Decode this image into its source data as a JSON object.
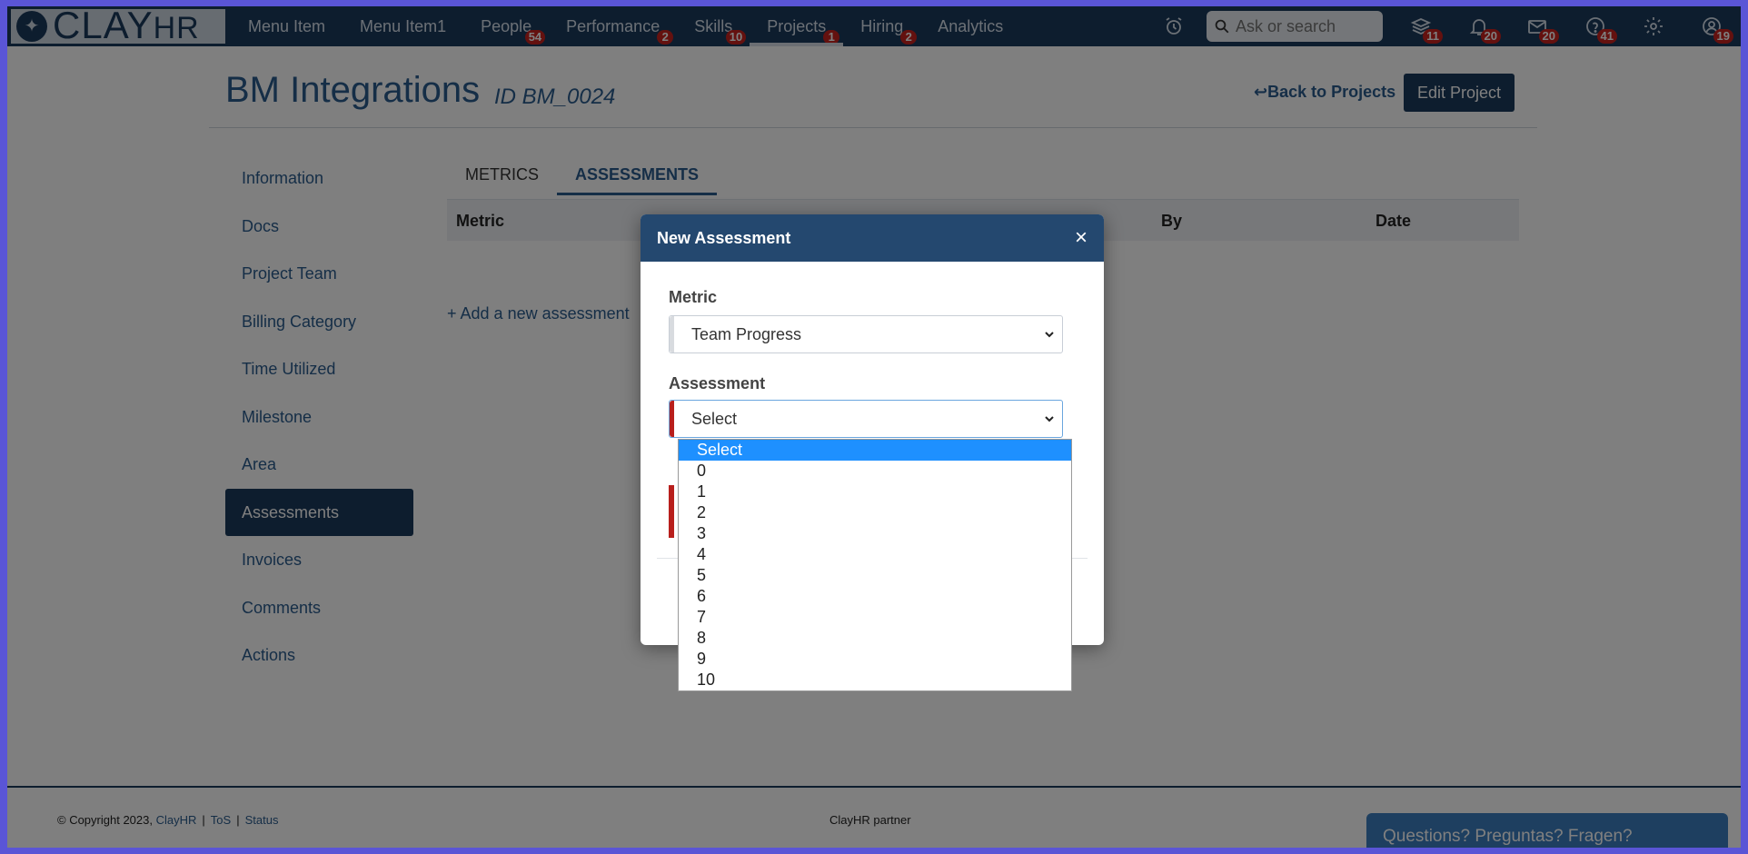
{
  "brand": {
    "logo_main": "CLAY",
    "logo_sub": "HR"
  },
  "nav": {
    "items": [
      {
        "label": "Menu Item",
        "badge": ""
      },
      {
        "label": "Menu Item1",
        "badge": ""
      },
      {
        "label": "People",
        "badge": "54"
      },
      {
        "label": "Performance",
        "badge": "2"
      },
      {
        "label": "Skills",
        "badge": "10"
      },
      {
        "label": "Projects",
        "badge": "1"
      },
      {
        "label": "Hiring",
        "badge": "2"
      },
      {
        "label": "Analytics",
        "badge": ""
      }
    ],
    "search_placeholder": "Ask or search",
    "badges": {
      "courses": "11",
      "notifications": "20",
      "messages": "20",
      "help": "41",
      "profile": "19"
    }
  },
  "page": {
    "title": "BM Integrations",
    "id": "ID BM_0024",
    "back_label": "Back to Projects",
    "edit_label": "Edit Project"
  },
  "sidebar": {
    "items": [
      {
        "label": "Information"
      },
      {
        "label": "Docs"
      },
      {
        "label": "Project Team"
      },
      {
        "label": "Billing Category"
      },
      {
        "label": "Time Utilized"
      },
      {
        "label": "Milestone"
      },
      {
        "label": "Area"
      },
      {
        "label": "Assessments"
      },
      {
        "label": "Invoices"
      },
      {
        "label": "Comments"
      },
      {
        "label": "Actions"
      }
    ]
  },
  "tabs": [
    {
      "label": "METRICS"
    },
    {
      "label": "ASSESSMENTS"
    }
  ],
  "table": {
    "headers": [
      "Metric",
      "By",
      "Date"
    ]
  },
  "add_assessment_label": "Add a new assessment",
  "modal": {
    "title": "New Assessment",
    "metric_label": "Metric",
    "metric_value": "Team Progress",
    "assessment_label": "Assessment",
    "assessment_value": "Select"
  },
  "dropdown_options": [
    "Select",
    "0",
    "1",
    "2",
    "3",
    "4",
    "5",
    "6",
    "7",
    "8",
    "9",
    "10"
  ],
  "footer": {
    "copyright": "© Copyright 2023,",
    "company": "ClayHR",
    "tos": "ToS",
    "status": "Status",
    "partner": "ClayHR partner",
    "help": "Questions? Preguntas? Fragen?"
  },
  "colors": {
    "nav_bg": "#1b3a5c",
    "accent": "#2b5c8e",
    "badge": "#c8231f",
    "highlight": "#1e90ff"
  }
}
